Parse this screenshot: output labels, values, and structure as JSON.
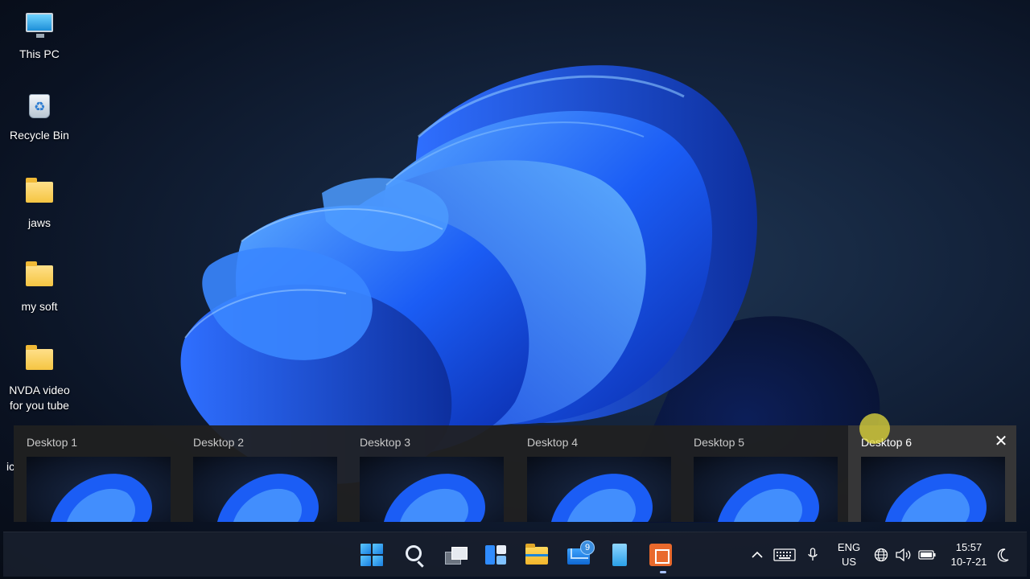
{
  "desktop": {
    "icons": [
      {
        "label": "This PC",
        "icon": "this-pc-icon"
      },
      {
        "label": "Recycle Bin",
        "icon": "recycle-bin-icon"
      },
      {
        "label": "jaws",
        "icon": "folder-icon"
      },
      {
        "label": "my soft",
        "icon": "folder-icon"
      },
      {
        "label": "NVDA video for you tube",
        "icon": "folder-icon"
      }
    ],
    "partial_label": "ic"
  },
  "task_view": {
    "desktops": [
      {
        "label": "Desktop 1"
      },
      {
        "label": "Desktop 2"
      },
      {
        "label": "Desktop 3"
      },
      {
        "label": "Desktop 4"
      },
      {
        "label": "Desktop 5"
      },
      {
        "label": "Desktop 6"
      }
    ],
    "hovered_index": 5,
    "close_glyph": "✕"
  },
  "taskbar": {
    "apps": [
      {
        "name": "start",
        "icon": "windows-start-icon"
      },
      {
        "name": "search",
        "icon": "search-icon"
      },
      {
        "name": "task-view",
        "icon": "task-view-icon"
      },
      {
        "name": "widgets",
        "icon": "widgets-icon"
      },
      {
        "name": "file-explorer",
        "icon": "folder-icon"
      },
      {
        "name": "mail",
        "icon": "mail-icon",
        "badge": "9"
      },
      {
        "name": "notepad",
        "icon": "notepad-icon"
      },
      {
        "name": "office-app",
        "icon": "office-icon"
      }
    ],
    "tray": {
      "chevron": "^",
      "language_line1": "ENG",
      "language_line2": "US",
      "time": "15:57",
      "date": "10-7-21"
    }
  },
  "colors": {
    "accent": "#1a7fe0",
    "taskbar_bg": "#181e2c",
    "taskview_bg": "#202020",
    "cursor_highlight": "#e6dc3c"
  }
}
